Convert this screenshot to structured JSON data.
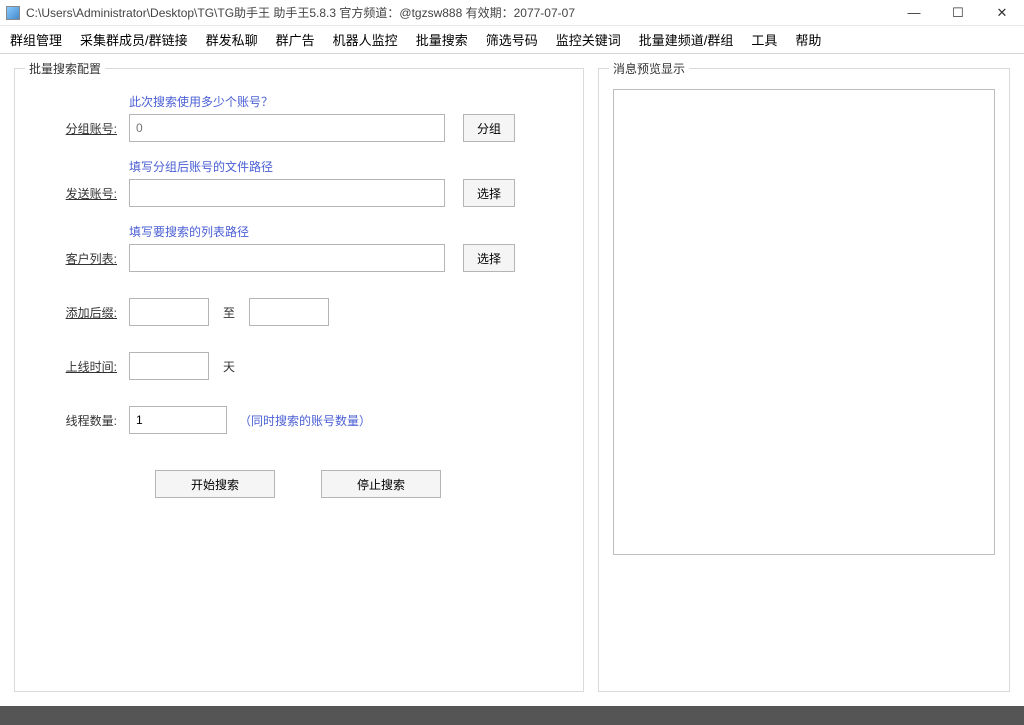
{
  "titlebar": {
    "text": "C:\\Users\\Administrator\\Desktop\\TG\\TG助手王   助手王5.8.3  官方频道：@tgzsw888      有效期：2077-07-07"
  },
  "menu": {
    "items": [
      "群组管理",
      "采集群成员/群链接",
      "群发私聊",
      "群广告",
      "机器人监控",
      "批量搜索",
      "筛选号码",
      "监控关键词",
      "批量建频道/群组",
      "工具",
      "帮助"
    ]
  },
  "leftPanel": {
    "title": "批量搜索配置",
    "hint1": "此次搜索使用多少个账号？",
    "row1": {
      "label": "分组账号:",
      "value": "",
      "placeholder": "0",
      "btn": "分组"
    },
    "hint2": "填写分组后账号的文件路径",
    "row2": {
      "label": "发送账号:",
      "value": "",
      "btn": "选择"
    },
    "hint3": "填写要搜索的列表路径",
    "row3": {
      "label": "客户列表:",
      "value": "",
      "btn": "选择"
    },
    "row4": {
      "label": "添加后缀:",
      "from": "",
      "to": "",
      "mid": "至"
    },
    "row5": {
      "label": "上线时间:",
      "value": "",
      "unit": "天"
    },
    "row6": {
      "label": "线程数量:",
      "value": "1",
      "note": "（同时搜索的账号数量）"
    },
    "actions": {
      "start": "开始搜索",
      "stop": "停止搜索"
    }
  },
  "rightPanel": {
    "title": "消息预览显示"
  },
  "winctl": {
    "min": "—",
    "max": "☐",
    "close": "✕"
  }
}
